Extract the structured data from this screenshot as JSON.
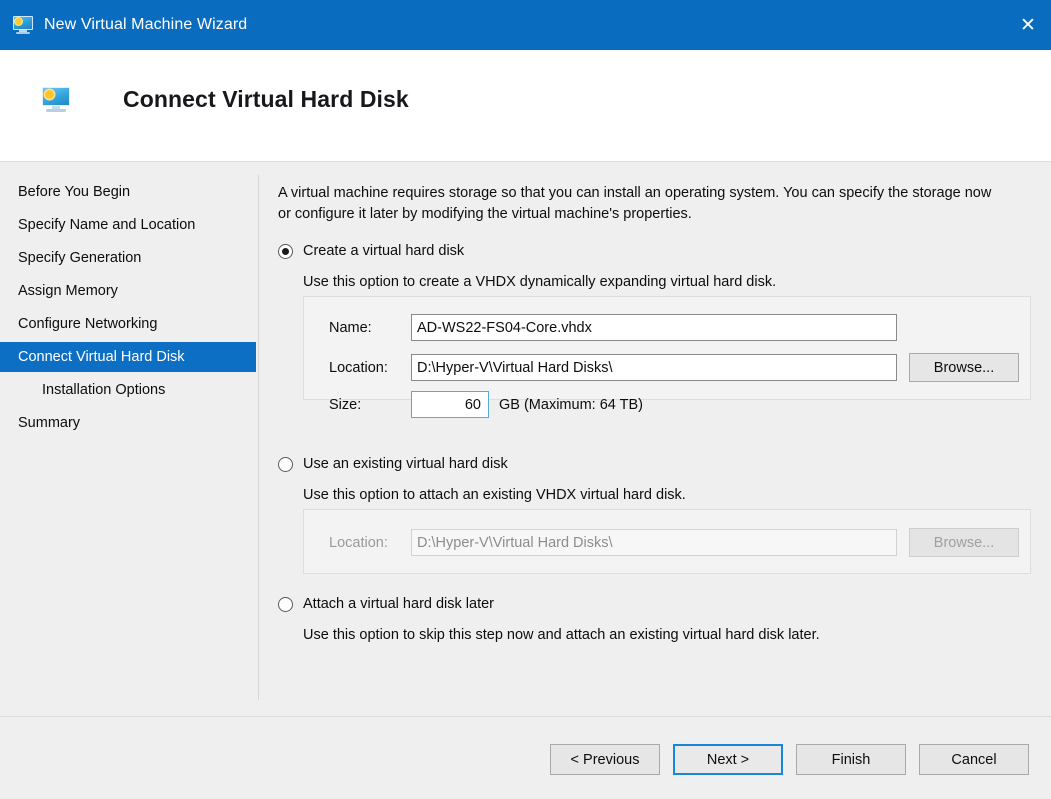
{
  "window": {
    "title": "New Virtual Machine Wizard",
    "icon": "vm-monitor-icon",
    "close_label": "✕",
    "accent_color": "#0a6cbe"
  },
  "header": {
    "title": "Connect Virtual Hard Disk",
    "icon": "vm-monitor-icon"
  },
  "sidebar": {
    "items": [
      {
        "label": "Before You Begin",
        "selected": false,
        "indent": false
      },
      {
        "label": "Specify Name and Location",
        "selected": false,
        "indent": false
      },
      {
        "label": "Specify Generation",
        "selected": false,
        "indent": false
      },
      {
        "label": "Assign Memory",
        "selected": false,
        "indent": false
      },
      {
        "label": "Configure Networking",
        "selected": false,
        "indent": false
      },
      {
        "label": "Connect Virtual Hard Disk",
        "selected": true,
        "indent": false
      },
      {
        "label": "Installation Options",
        "selected": false,
        "indent": true
      },
      {
        "label": "Summary",
        "selected": false,
        "indent": false
      }
    ],
    "selected_background": "#0d6fc3"
  },
  "main": {
    "intro": "A virtual machine requires storage so that you can install an operating system. You can specify the storage now or configure it later by modifying the virtual machine's properties.",
    "options": [
      {
        "label": "Create a virtual hard disk",
        "description": "Use this option to create a VHDX dynamically expanding virtual hard disk.",
        "selected": true
      },
      {
        "label": "Use an existing virtual hard disk",
        "description": "Use this option to attach an existing VHDX virtual hard disk.",
        "selected": false
      },
      {
        "label": "Attach a virtual hard disk later",
        "description": "Use this option to skip this step now and attach an existing virtual hard disk later.",
        "selected": false
      }
    ],
    "create_group": {
      "name_label": "Name:",
      "name_value": "AD-WS22-FS04-Core.vhdx",
      "location_label": "Location:",
      "location_value": "D:\\Hyper-V\\Virtual Hard Disks\\",
      "browse_label": "Browse...",
      "size_label": "Size:",
      "size_value": "60",
      "size_unit": "GB (Maximum: 64 TB)"
    },
    "existing_group": {
      "location_label": "Location:",
      "location_value": "D:\\Hyper-V\\Virtual Hard Disks\\",
      "browse_label": "Browse...",
      "disabled": true
    }
  },
  "footer": {
    "previous_label": "< Previous",
    "next_label": "Next >",
    "finish_label": "Finish",
    "cancel_label": "Cancel",
    "default_button": "next",
    "default_border_color": "#1a86d9"
  }
}
